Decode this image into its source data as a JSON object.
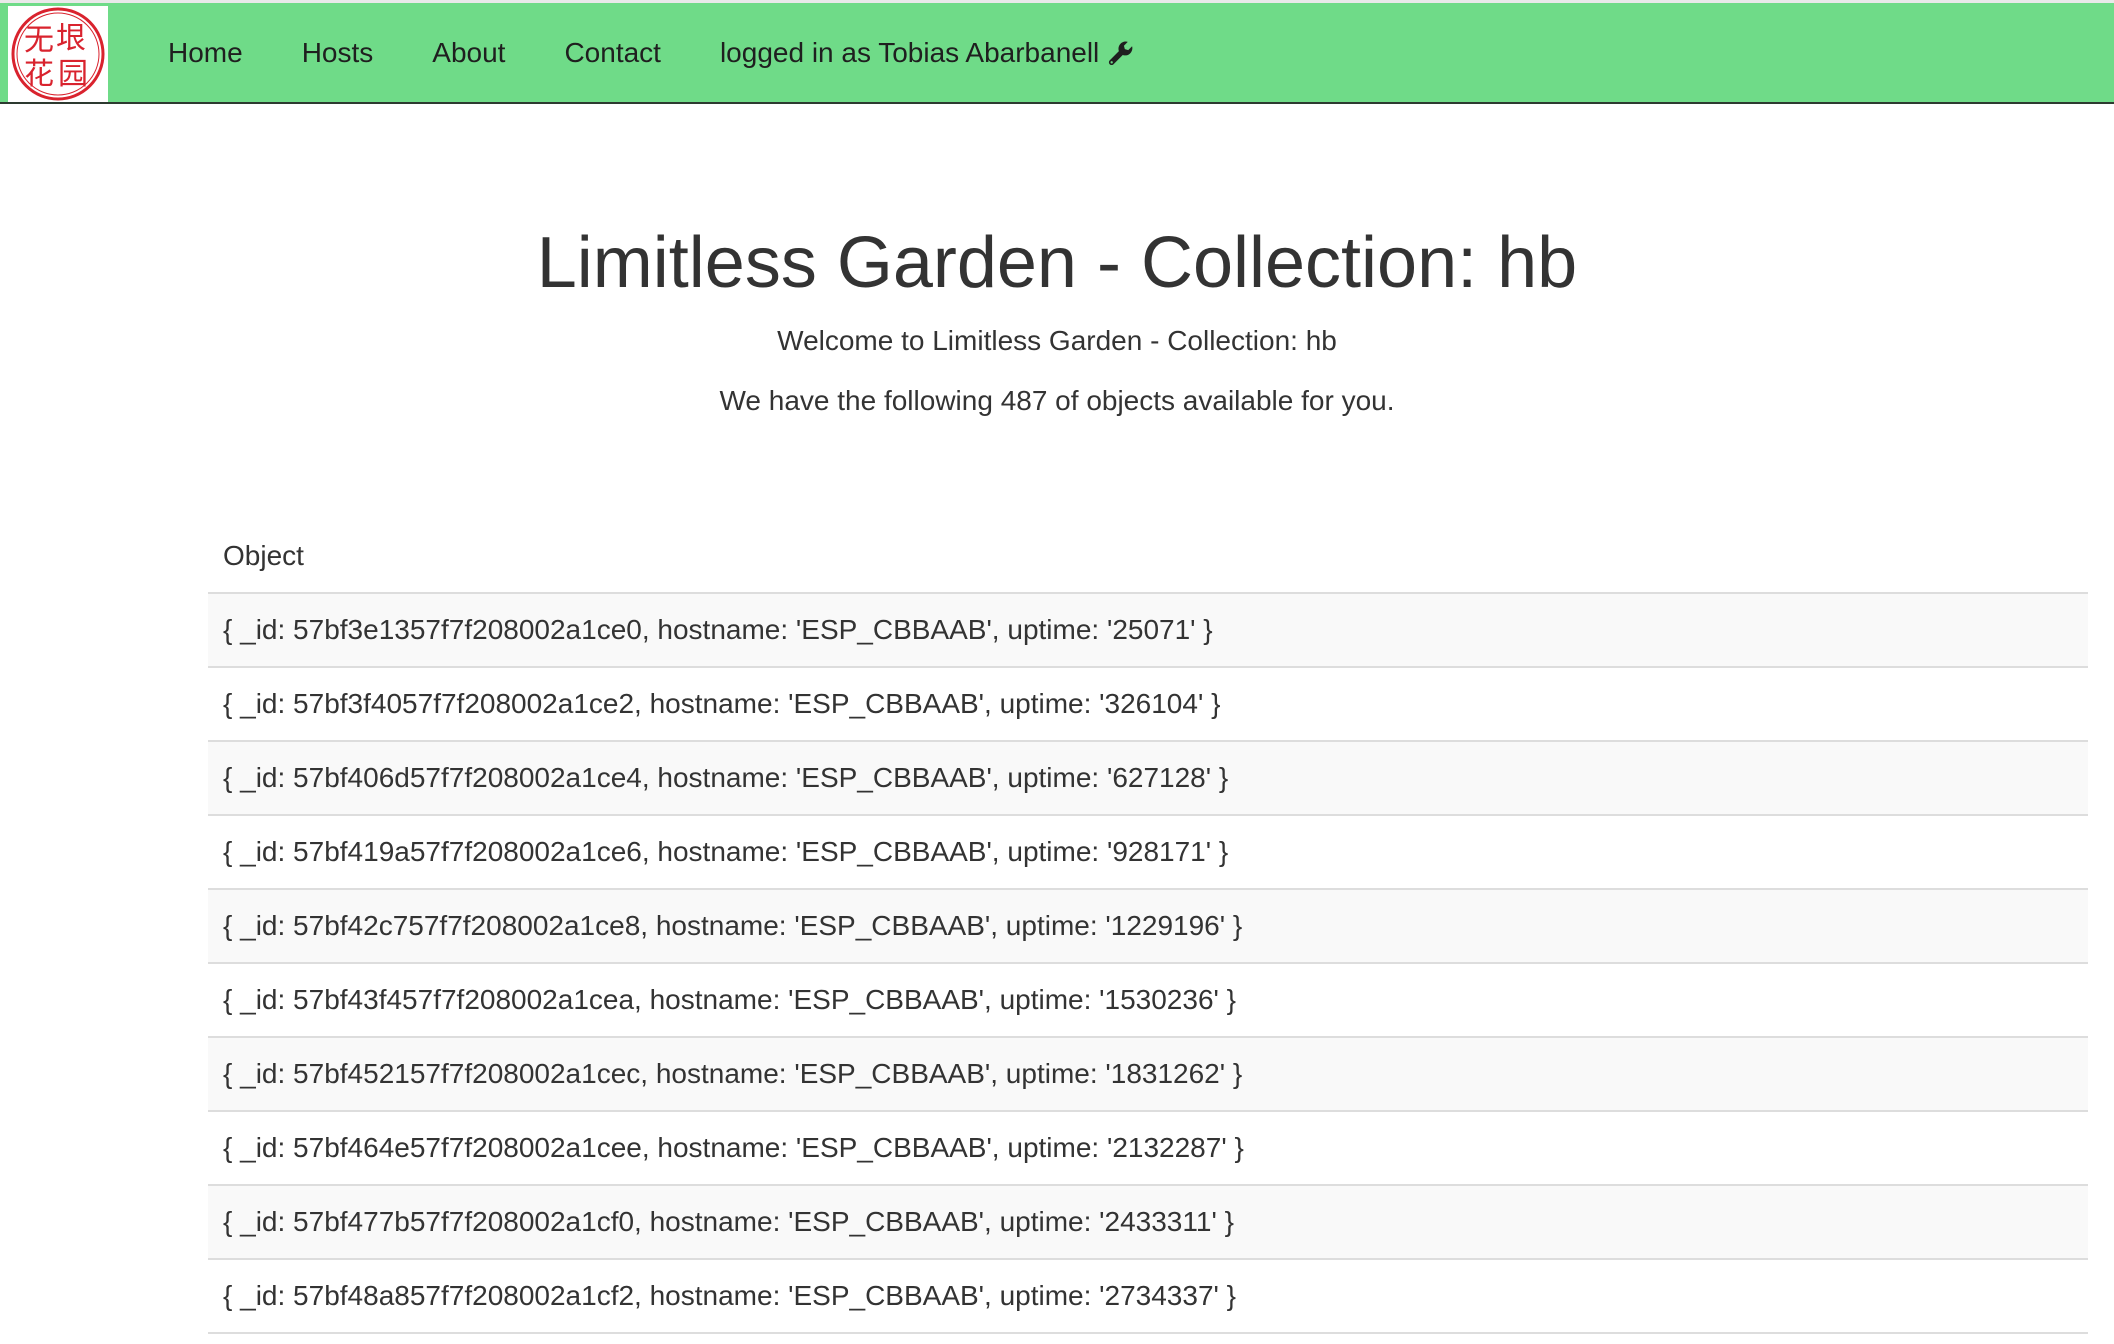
{
  "nav": {
    "logo_text": "无垠花园",
    "items": [
      {
        "label": "Home"
      },
      {
        "label": "Hosts"
      },
      {
        "label": "About"
      },
      {
        "label": "Contact"
      }
    ],
    "user_label": "logged in as Tobias Abarbanell",
    "user_icon": "wrench-icon"
  },
  "main": {
    "title": "Limitless Garden - Collection: hb",
    "welcome": "Welcome to Limitless Garden - Collection: hb",
    "count_text": "We have the following 487 of objects available for you."
  },
  "table": {
    "header": "Object",
    "rows": [
      "{ _id: 57bf3e1357f7f208002a1ce0, hostname: 'ESP_CBBAAB', uptime: '25071' }",
      "{ _id: 57bf3f4057f7f208002a1ce2, hostname: 'ESP_CBBAAB', uptime: '326104' }",
      "{ _id: 57bf406d57f7f208002a1ce4, hostname: 'ESP_CBBAAB', uptime: '627128' }",
      "{ _id: 57bf419a57f7f208002a1ce6, hostname: 'ESP_CBBAAB', uptime: '928171' }",
      "{ _id: 57bf42c757f7f208002a1ce8, hostname: 'ESP_CBBAAB', uptime: '1229196' }",
      "{ _id: 57bf43f457f7f208002a1cea, hostname: 'ESP_CBBAAB', uptime: '1530236' }",
      "{ _id: 57bf452157f7f208002a1cec, hostname: 'ESP_CBBAAB', uptime: '1831262' }",
      "{ _id: 57bf464e57f7f208002a1cee, hostname: 'ESP_CBBAAB', uptime: '2132287' }",
      "{ _id: 57bf477b57f7f208002a1cf0, hostname: 'ESP_CBBAAB', uptime: '2433311' }",
      "{ _id: 57bf48a857f7f208002a1cf2, hostname: 'ESP_CBBAAB', uptime: '2734337' }"
    ]
  },
  "colors": {
    "navbar_bg": "#6fdb88",
    "logo_red": "#d9232e",
    "row_stripe": "#f9f9f9"
  }
}
